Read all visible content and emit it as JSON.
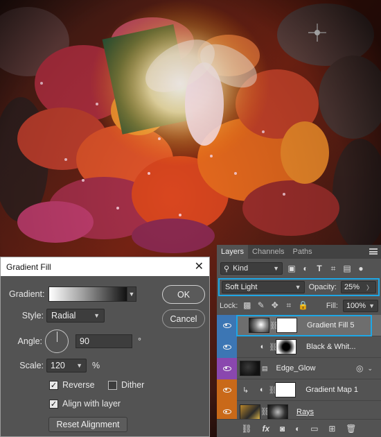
{
  "canvas": {
    "description_icon": "fairy-autumn-leaves-artwork"
  },
  "layers_panel": {
    "tabs": [
      "Layers",
      "Channels",
      "Paths"
    ],
    "filter": {
      "kind_label": "Kind"
    },
    "blend_mode": "Soft Light",
    "opacity_label": "Opacity:",
    "opacity_value": "25%",
    "lock_label": "Lock:",
    "fill_label": "Fill:",
    "fill_value": "100%",
    "layers": [
      {
        "name": "Gradient Fill 5",
        "label_color": "blue",
        "selected": true
      },
      {
        "name": "Black & Whit...",
        "label_color": "blue",
        "selected": false
      },
      {
        "name": "Edge_Glow",
        "label_color": "purple",
        "selected": false
      },
      {
        "name": "Gradient Map 1",
        "label_color": "orange",
        "selected": false
      },
      {
        "name": "Rays",
        "label_color": "orange",
        "selected": false
      }
    ],
    "bottom_icons": [
      "link-icon",
      "fx-icon",
      "mask-icon",
      "adjustment-icon",
      "folder-icon",
      "new-layer-icon",
      "trash-icon"
    ],
    "bottom_fx_label": "fx"
  },
  "dialog": {
    "title": "Gradient Fill",
    "close_glyph": "✕",
    "gradient_label": "Gradient:",
    "style_label": "Style:",
    "style_value": "Radial",
    "angle_label": "Angle:",
    "angle_value": "90",
    "angle_unit": "°",
    "scale_label": "Scale:",
    "scale_value": "120",
    "scale_unit": "%",
    "reverse_label": "Reverse",
    "reverse_checked": true,
    "dither_label": "Dither",
    "dither_checked": false,
    "align_label": "Align with layer",
    "align_checked": true,
    "reset_label": "Reset Alignment",
    "ok_label": "OK",
    "cancel_label": "Cancel"
  },
  "colors": {
    "accent_highlight": "#1ea7e6",
    "label_blue": "#3c76b4",
    "label_purple": "#8a47ae",
    "label_orange": "#c96919",
    "panel_bg": "#535353"
  }
}
